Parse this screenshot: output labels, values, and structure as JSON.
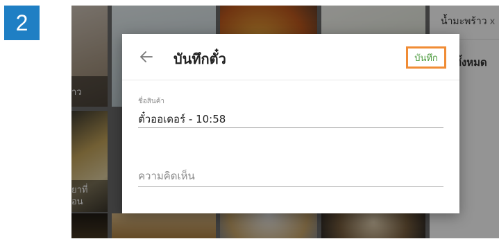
{
  "step_number": "2",
  "background": {
    "tile_top_left_label": "าว",
    "tile_mid_left_label_line1": "ยาที่",
    "tile_mid_left_label_line2": "อน",
    "filter_tag": "น้ำมะพร้าว",
    "filter_tag_close": "x",
    "all_label": "ทั้งหมด"
  },
  "dialog": {
    "back_icon": "arrow-left-icon",
    "title": "บันทึกตั๋ว",
    "save_label": "บันทึก",
    "name_field": {
      "label": "ชื่อสินค้า",
      "value": "ตั๋วออเดอร์ - 10:58"
    },
    "comment_field": {
      "placeholder": "ความคิดเห็น"
    }
  },
  "colors": {
    "step_badge": "#1f7fc4",
    "save_highlight_border": "#f08c35",
    "save_text": "#4a9a3c"
  }
}
